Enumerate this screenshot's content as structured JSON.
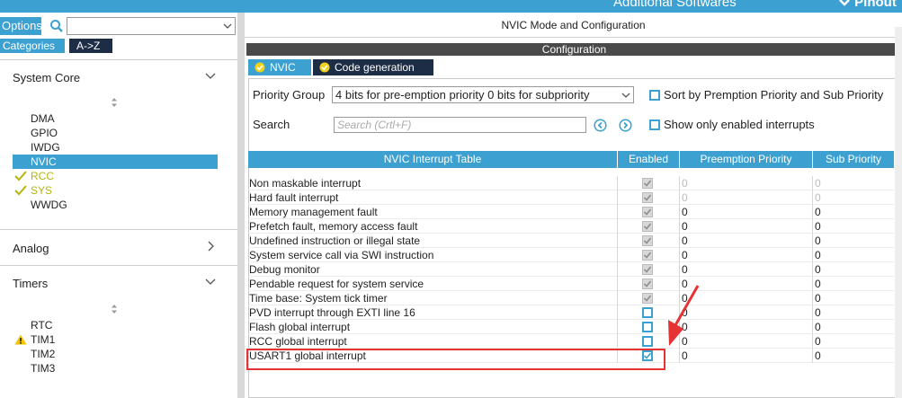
{
  "topbar": {
    "additional_software": "Additional Softwares",
    "pinout": "Pinout"
  },
  "left": {
    "options_label": "Options",
    "search_value": "",
    "categories_label": "Categories",
    "az_label": "A->Z",
    "sections": {
      "system_core": {
        "label": "System Core",
        "items": [
          {
            "label": "DMA",
            "state": "normal"
          },
          {
            "label": "GPIO",
            "state": "normal"
          },
          {
            "label": "IWDG",
            "state": "normal"
          },
          {
            "label": "NVIC",
            "state": "selected"
          },
          {
            "label": "RCC",
            "state": "ok"
          },
          {
            "label": "SYS",
            "state": "ok"
          },
          {
            "label": "WWDG",
            "state": "normal"
          }
        ]
      },
      "analog": {
        "label": "Analog"
      },
      "timers": {
        "label": "Timers",
        "items": [
          {
            "label": "RTC",
            "state": "normal"
          },
          {
            "label": "TIM1",
            "state": "warning"
          },
          {
            "label": "TIM2",
            "state": "normal"
          },
          {
            "label": "TIM3",
            "state": "normal"
          }
        ]
      }
    }
  },
  "right": {
    "title": "NVIC Mode and Configuration",
    "config_label": "Configuration",
    "tabs": [
      {
        "label": "NVIC"
      },
      {
        "label": "Code generation"
      }
    ],
    "priority_group_label": "Priority Group",
    "priority_group_value": "4 bits for pre-emption priority 0 bits for subpriority",
    "sort_label": "Sort by Premption Priority and Sub Priority",
    "search_label": "Search",
    "search_placeholder": "Search (Crtl+F)",
    "show_enabled_label": "Show only enabled interrupts"
  },
  "table": {
    "headers": [
      "NVIC Interrupt Table",
      "Enabled",
      "Preemption Priority",
      "Sub Priority"
    ],
    "rows": [
      {
        "name": "Non maskable interrupt",
        "enabled": "locked",
        "pre": "0",
        "sub": "0",
        "dim": true
      },
      {
        "name": "Hard fault interrupt",
        "enabled": "locked",
        "pre": "0",
        "sub": "0",
        "dim": true
      },
      {
        "name": "Memory management fault",
        "enabled": "locked",
        "pre": "0",
        "sub": "0",
        "dim": false
      },
      {
        "name": "Prefetch fault, memory access fault",
        "enabled": "locked",
        "pre": "0",
        "sub": "0",
        "dim": false
      },
      {
        "name": "Undefined instruction or illegal state",
        "enabled": "locked",
        "pre": "0",
        "sub": "0",
        "dim": false
      },
      {
        "name": "System service call via SWI instruction",
        "enabled": "locked",
        "pre": "0",
        "sub": "0",
        "dim": false
      },
      {
        "name": "Debug monitor",
        "enabled": "locked",
        "pre": "0",
        "sub": "0",
        "dim": false
      },
      {
        "name": "Pendable request for system service",
        "enabled": "locked",
        "pre": "0",
        "sub": "0",
        "dim": false
      },
      {
        "name": "Time base: System tick timer",
        "enabled": "locked",
        "pre": "0",
        "sub": "0",
        "dim": false
      },
      {
        "name": "PVD interrupt through EXTI line 16",
        "enabled": "off",
        "pre": "0",
        "sub": "0",
        "dim": false
      },
      {
        "name": "Flash global interrupt",
        "enabled": "off",
        "pre": "0",
        "sub": "0",
        "dim": false
      },
      {
        "name": "RCC global interrupt",
        "enabled": "off",
        "pre": "0",
        "sub": "0",
        "dim": false
      },
      {
        "name": "USART1 global interrupt",
        "enabled": "on",
        "pre": "0",
        "sub": "0",
        "dim": false
      }
    ]
  },
  "colors": {
    "accent": "#3ca0d0",
    "dark_tab": "#1d2d46",
    "ok": "#b5b50a",
    "warning": "#f5c400",
    "annotation": "#e53232"
  }
}
